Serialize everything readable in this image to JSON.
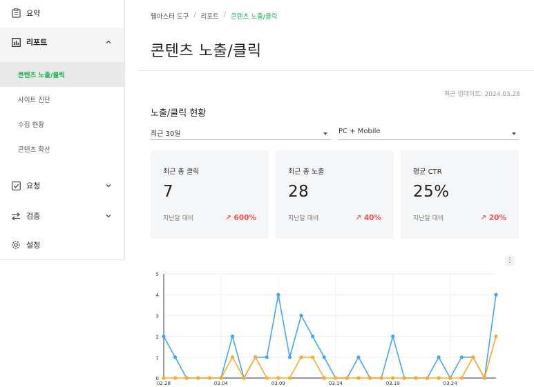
{
  "sidebar": {
    "items": [
      {
        "label": "요약",
        "icon": "clipboard-icon"
      },
      {
        "label": "리포트",
        "icon": "bar-chart-icon",
        "expanded": true,
        "sub": [
          {
            "label": "콘텐츠 노출/클릭",
            "active": true
          },
          {
            "label": "사이트 진단"
          },
          {
            "label": "수집 현황"
          },
          {
            "label": "콘텐츠 확산"
          }
        ]
      },
      {
        "label": "요청",
        "icon": "check-square-icon"
      },
      {
        "label": "검증",
        "icon": "swap-icon"
      },
      {
        "label": "설정",
        "icon": "gear-icon"
      }
    ]
  },
  "breadcrumb": [
    "웹마스터 도구",
    "리포트",
    "콘텐츠 노출/클릭"
  ],
  "page_title": "콘텐츠 노출/클릭",
  "updated": "최근 업데이트: 2024.03.28",
  "section_title": "노출/클릭 현황",
  "filters": {
    "period": "최근 30일",
    "device": "PC + Mobile"
  },
  "cards": [
    {
      "label": "최근 총 클릭",
      "value": "7",
      "foot": "지난달 대비",
      "delta": "↗ 600%"
    },
    {
      "label": "최근 총 노출",
      "value": "28",
      "foot": "지난달 대비",
      "delta": "↗ 40%"
    },
    {
      "label": "평균 CTR",
      "value": "25%",
      "foot": "지난달 대비",
      "delta": "↗ 20%"
    }
  ],
  "colors": {
    "accent": "#19b34a",
    "delta": "#ff4d4d",
    "impressions": "#42a5f5",
    "clicks": "#ffa726"
  },
  "chart_data": {
    "type": "line",
    "x": [
      "02.28",
      "02.29",
      "03.01",
      "03.02",
      "03.03",
      "03.04",
      "03.05",
      "03.06",
      "03.07",
      "03.08",
      "03.09",
      "03.10",
      "03.11",
      "03.12",
      "03.13",
      "03.14",
      "03.15",
      "03.16",
      "03.17",
      "03.18",
      "03.19",
      "03.20",
      "03.21",
      "03.22",
      "03.23",
      "03.24",
      "03.25",
      "03.26",
      "03.27",
      "03.28"
    ],
    "xticks": [
      "02.28",
      "03.04",
      "03.09",
      "03.14",
      "03.19",
      "03.24"
    ],
    "ylim": [
      0,
      5
    ],
    "yticks": [
      0,
      1,
      2,
      3,
      4,
      5
    ],
    "series": [
      {
        "values": [
          2,
          1,
          0,
          0,
          0,
          0,
          2,
          0,
          1,
          1,
          4,
          1,
          3,
          2,
          1,
          0,
          0,
          1,
          0,
          0,
          2,
          0,
          0,
          0,
          1,
          0,
          1,
          1,
          0,
          4
        ]
      },
      {
        "values": [
          0,
          0,
          0,
          0,
          0,
          0,
          1,
          0,
          1,
          0,
          0,
          0,
          1,
          1,
          0,
          0,
          0,
          0,
          0,
          0,
          0,
          0,
          0,
          0,
          0,
          0,
          0,
          1,
          0,
          2
        ]
      }
    ]
  }
}
